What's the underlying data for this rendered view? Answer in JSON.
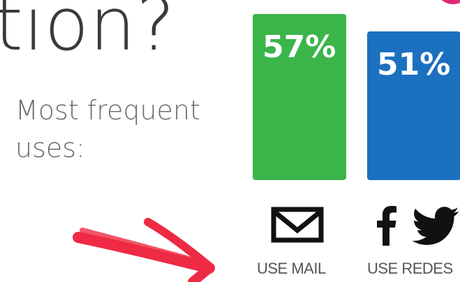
{
  "header": {
    "title_fragment": "tion?",
    "subtitle": "Most frequent uses:"
  },
  "colors": {
    "mail_bar": "#3bb54a",
    "social_bar": "#1c70c0",
    "accent_arrow": "#ee2a44",
    "corner_mark": "#e2267a"
  },
  "icons": {
    "mail": "envelope-icon",
    "social": [
      "facebook-icon",
      "twitter-icon"
    ]
  },
  "chart_data": {
    "type": "bar",
    "categories": [
      "USE MAIL",
      "USE REDES"
    ],
    "values": [
      57,
      51
    ],
    "value_labels": [
      "57%",
      "51%"
    ],
    "unit": "%",
    "ylim": [
      0,
      70
    ],
    "title": "",
    "xlabel": "",
    "ylabel": "",
    "grid": false,
    "legend": "none"
  }
}
